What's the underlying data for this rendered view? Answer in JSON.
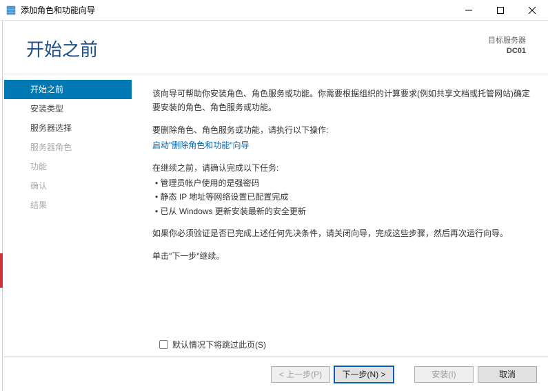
{
  "window": {
    "title": "添加角色和功能向导"
  },
  "header": {
    "page_title": "开始之前",
    "target_label": "目标服务器",
    "target_name": "DC01"
  },
  "nav": {
    "items": [
      {
        "label": "开始之前",
        "state": "active"
      },
      {
        "label": "安装类型",
        "state": "normal"
      },
      {
        "label": "服务器选择",
        "state": "normal"
      },
      {
        "label": "服务器角色",
        "state": "disabled"
      },
      {
        "label": "功能",
        "state": "disabled"
      },
      {
        "label": "确认",
        "state": "disabled"
      },
      {
        "label": "结果",
        "state": "disabled"
      }
    ]
  },
  "content": {
    "intro": "该向导可帮助你安装角色、角色服务或功能。你需要根据组织的计算要求(例如共享文档或托管网站)确定要安装的角色、角色服务或功能。",
    "remove_label": "要删除角色、角色服务或功能，请执行以下操作:",
    "remove_link": "启动\"删除角色和功能\"向导",
    "proceed_label": "在继续之前，请确认完成以下任务:",
    "checklist": [
      "管理员帐户使用的是强密码",
      "静态 IP 地址等网络设置已配置完成",
      "已从 Windows 更新安装最新的安全更新"
    ],
    "verify_note": "如果你必须验证是否已完成上述任何先决条件，请关闭向导，完成这些步骤，然后再次运行向导。",
    "continue_note": "单击\"下一步\"继续。",
    "skip_checkbox_label": "默认情况下将跳过此页(S)"
  },
  "footer": {
    "prev": "< 上一步(P)",
    "next": "下一步(N) >",
    "install": "安装(I)",
    "cancel": "取消"
  }
}
